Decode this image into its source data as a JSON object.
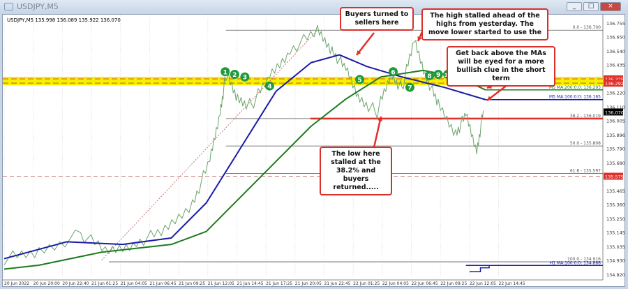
{
  "window": {
    "title": "USDJPY,M5",
    "buttons": [
      "_",
      "□",
      "×"
    ]
  },
  "info_line": "USDJPY,M5  135.998 136.089 135.922 136.070",
  "colors": {
    "price": "#6aa36a",
    "ma100": "#1a1aa8",
    "ma200": "#1e7a1e",
    "annot": "#e0302a",
    "band": "#f5f000",
    "fib": "#555555"
  },
  "chart_data": {
    "type": "line",
    "title": "USDJPY,M5",
    "ylim": [
      134.78,
      136.8
    ],
    "y_ticks": [
      136.755,
      136.65,
      136.54,
      136.435,
      136.22,
      136.11,
      136.005,
      135.896,
      135.79,
      135.68,
      135.465,
      135.36,
      135.25,
      135.145,
      135.035,
      134.93,
      134.82
    ],
    "x_ticks": [
      "20 Jun 2022",
      "20 Jun 20:00",
      "20 Jun 22:40",
      "21 Jun 01:25",
      "21 Jun 04:05",
      "21 Jun 06:45",
      "21 Jun 09:25",
      "21 Jun 12:05",
      "21 Jun 14:45",
      "21 Jun 17:25",
      "21 Jun 20:05",
      "21 Jun 22:45",
      "22 Jun 01:25",
      "22 Jun 04:05",
      "22 Jun 06:45",
      "22 Jun 09:25",
      "22 Jun 12:05",
      "22 Jun 14:45"
    ],
    "bars_per_tick": 40,
    "series": [
      {
        "name": "USDJPY close",
        "x": [
          5,
          53,
          110,
          149,
          187,
          226,
          264,
          288,
          302,
          310,
          326,
          345,
          370,
          398,
          436,
          456,
          475,
          494,
          518,
          537,
          552,
          569,
          586,
          602,
          626,
          640,
          655,
          664
        ],
        "y": [
          134.94,
          134.99,
          135.13,
          134.99,
          135.07,
          135.15,
          135.37,
          135.69,
          136.07,
          136.36,
          136.17,
          136.12,
          136.34,
          136.55,
          136.69,
          136.55,
          136.39,
          136.17,
          136.07,
          136.36,
          136.25,
          136.62,
          136.34,
          136.12,
          135.91,
          136.04,
          135.77,
          136.08
        ]
      },
      {
        "name": "M5 MA 100",
        "x": [
          5,
          91,
          168,
          235,
          283,
          331,
          379,
          427,
          466,
          504,
          552,
          610,
          667
        ],
        "y": [
          134.94,
          135.07,
          135.05,
          135.1,
          135.37,
          135.8,
          136.23,
          136.45,
          136.51,
          136.42,
          136.34,
          136.26,
          136.165
        ]
      },
      {
        "name": "M5 MA 200",
        "x": [
          5,
          53,
          139,
          235,
          283,
          331,
          379,
          427,
          475,
          523,
          581,
          629,
          667
        ],
        "y": [
          134.86,
          134.89,
          134.99,
          135.05,
          135.15,
          135.42,
          135.69,
          135.96,
          136.17,
          136.34,
          136.39,
          136.34,
          136.24
        ]
      }
    ],
    "levels": [
      {
        "label": "0.0 - 136.700",
        "value": 136.7,
        "kind": "fib"
      },
      {
        "label": "38.2 - 136.019",
        "value": 136.019,
        "kind": "fib"
      },
      {
        "label": "50.0 - 135.808",
        "value": 135.808,
        "kind": "fib"
      },
      {
        "label": "61.8 - 135.597",
        "value": 135.597,
        "kind": "fib"
      },
      {
        "label": "100.0 - 134.916",
        "value": 134.916,
        "kind": "fib"
      },
      {
        "label": "M5 MA:200:0:0: 136.293",
        "value": 136.24,
        "kind": "ma200"
      },
      {
        "label": "M5 MA:100:0:0: 136.165",
        "value": 136.165,
        "kind": "ma100"
      },
      {
        "label": "H1 MA:100:0:0: 134.888",
        "value": 134.888,
        "kind": "h1ma"
      }
    ],
    "price_tags": [
      {
        "label": "136.325",
        "value": 136.325,
        "color": "#e0302a"
      },
      {
        "label": "136.292",
        "value": 136.292,
        "color": "#e0302a"
      },
      {
        "label": "136.070",
        "value": 136.07,
        "color": "#000000"
      },
      {
        "label": "135.575",
        "value": 135.575,
        "color": "#e0302a"
      }
    ],
    "band": [
      136.292,
      136.325
    ],
    "markers": [
      {
        "label": "1",
        "x": 309,
        "y": 136.38
      },
      {
        "label": "2",
        "x": 322,
        "y": 136.36
      },
      {
        "label": "3",
        "x": 336,
        "y": 136.34
      },
      {
        "label": "4",
        "x": 370,
        "y": 136.27
      },
      {
        "label": "5",
        "x": 494,
        "y": 136.32
      },
      {
        "label": "6",
        "x": 540,
        "y": 136.38
      },
      {
        "label": "7",
        "x": 563,
        "y": 136.26
      },
      {
        "label": "8",
        "x": 590,
        "y": 136.35
      },
      {
        "label": "9",
        "x": 602,
        "y": 136.36
      },
      {
        "label": "10",
        "x": 615,
        "y": 136.36
      }
    ]
  },
  "callouts": [
    {
      "text": "Buyers turned to sellers here"
    },
    {
      "text": "The high stalled ahead of the highs from yesterday.  The move lower started to use the"
    },
    {
      "text": "Get back above the MAs will be eyed for a more bullish clue in the short term"
    },
    {
      "text": "The low here stalled at the 38.2% and buyers returned....."
    }
  ]
}
